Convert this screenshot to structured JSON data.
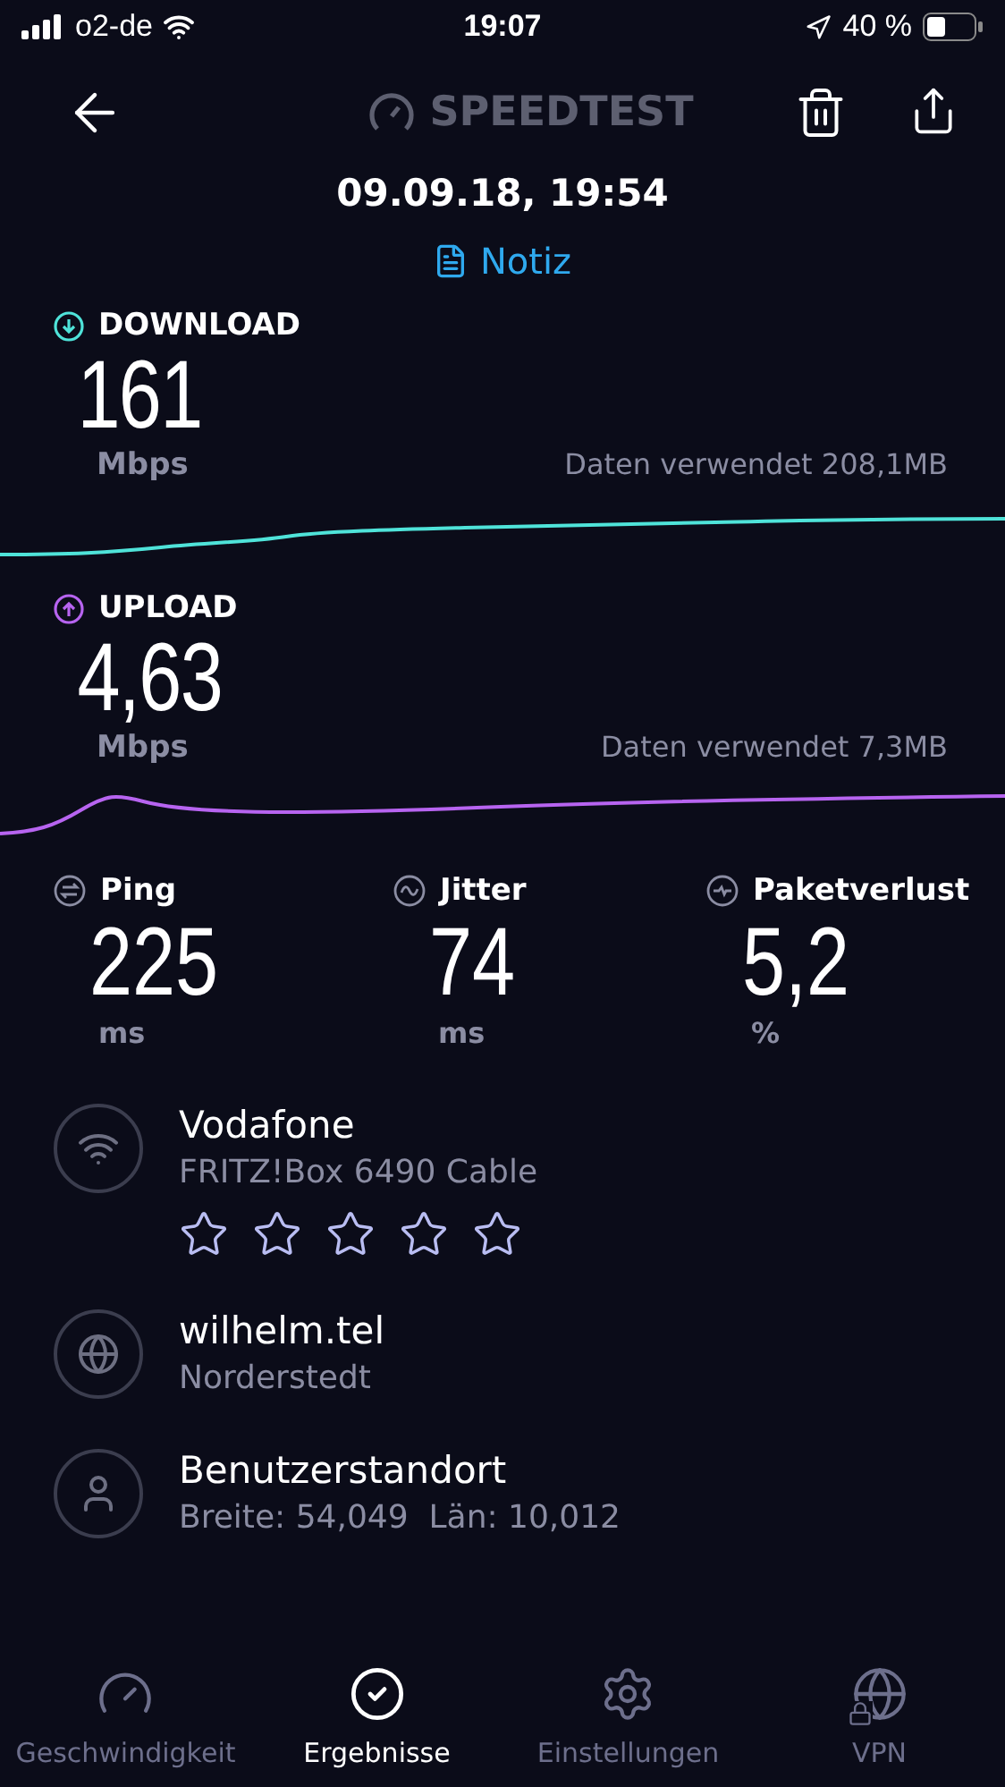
{
  "status_bar": {
    "carrier": "o2-de",
    "time": "19:07",
    "battery": "40 %"
  },
  "header": {
    "logo": "SPEEDTEST",
    "date": "09.09.18, 19:54",
    "note": "Notiz"
  },
  "tests": [
    {
      "kind": "download",
      "label": "DOWNLOAD",
      "value": "161",
      "unit": "Mbps",
      "data_used": "Daten verwendet 208,1MB",
      "color": "#4fe3d9"
    },
    {
      "kind": "upload",
      "label": "UPLOAD",
      "value": "4,63",
      "unit": "Mbps",
      "data_used": "Daten verwendet 7,3MB",
      "color": "#b764f0"
    }
  ],
  "metrics": [
    {
      "kind": "ping",
      "label": "Ping",
      "value": "225",
      "unit": "ms"
    },
    {
      "kind": "jitter",
      "label": "Jitter",
      "value": "74",
      "unit": "ms"
    },
    {
      "kind": "loss",
      "label": "Paketverlust",
      "value": "5,2",
      "unit": "%"
    }
  ],
  "info": [
    {
      "kind": "wifi",
      "title": "Vodafone",
      "subtitle": "FRITZ!Box 6490 Cable",
      "stars": 0
    },
    {
      "kind": "server",
      "title": "wilhelm.tel",
      "subtitle": "Norderstedt"
    },
    {
      "kind": "user",
      "title": "Benutzerstandort",
      "subtitle": "Breite: 54,049  Län: 10,012"
    }
  ],
  "tabs": [
    {
      "kind": "speed",
      "label": "Geschwindigkeit",
      "selected": false
    },
    {
      "kind": "results",
      "label": "Ergebnisse",
      "selected": true
    },
    {
      "kind": "settings",
      "label": "Einstellungen",
      "selected": false
    },
    {
      "kind": "vpn",
      "label": "VPN",
      "selected": false
    }
  ]
}
